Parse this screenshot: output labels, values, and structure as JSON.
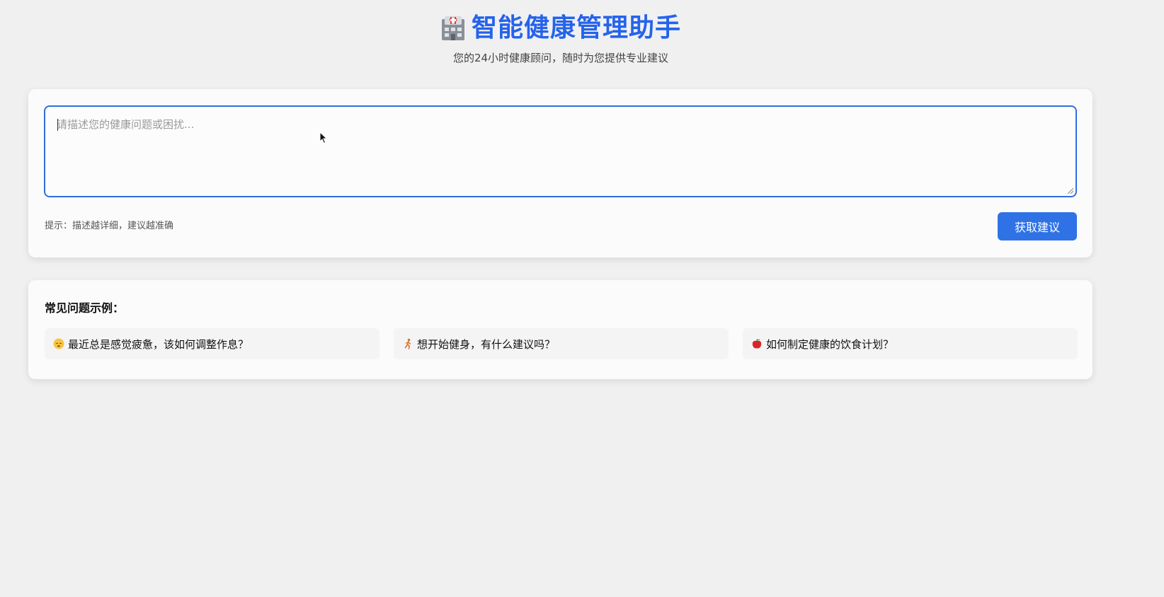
{
  "header": {
    "icon": "hospital-icon",
    "title": "智能健康管理助手",
    "subtitle": "您的24小时健康顾问，随时为您提供专业建议"
  },
  "input_card": {
    "textarea": {
      "value": "",
      "placeholder": "请描述您的健康问题或困扰..."
    },
    "hint": "提示：描述越详细，建议越准确",
    "submit_label": "获取建议"
  },
  "examples": {
    "title": "常见问题示例：",
    "items": [
      {
        "icon": "sleepy-face-icon",
        "text": "最近总是感觉疲惫，该如何调整作息？"
      },
      {
        "icon": "running-person-icon",
        "text": "想开始健身，有什么建议吗？"
      },
      {
        "icon": "apple-icon",
        "text": "如何制定健康的饮食计划？"
      }
    ]
  },
  "colors": {
    "accent": "#2563eb",
    "button": "#2f72e6",
    "background": "#f0f0f1",
    "card": "#fbfbfb"
  }
}
